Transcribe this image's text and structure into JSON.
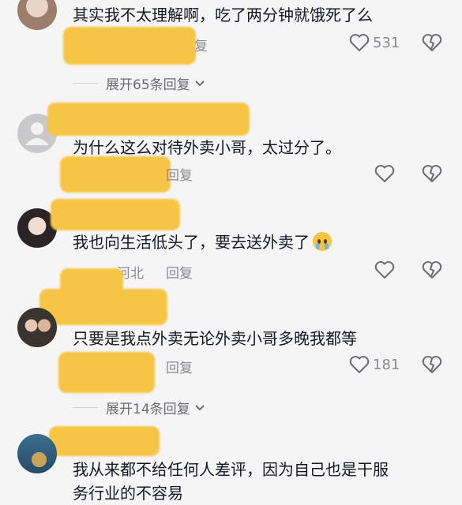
{
  "comments": [
    {
      "text": "其实我不太理解啊，吃了两分钟就饿死了么",
      "reply": "复",
      "likes": "531"
    },
    {
      "text": "为什么这么对待外卖小哥，太过分了。",
      "reply": "回复"
    },
    {
      "text": "我也向生活低头了，要去送外卖了",
      "location": "河北",
      "reply": "回复"
    },
    {
      "text": "只要是我点外卖无论外卖小哥多晚我都等",
      "reply": "回复",
      "likes": "181"
    },
    {
      "text_line1": "我从来都不给任何人差评，因为自己也是干服",
      "text_line2": "务行业的不容易"
    }
  ],
  "expand_replies": [
    {
      "label": "展开65条回复"
    },
    {
      "label": "展开14条回复"
    }
  ],
  "colors": {
    "highlight": "#f6c545",
    "text": "#161823",
    "meta": "#8a8b91"
  }
}
